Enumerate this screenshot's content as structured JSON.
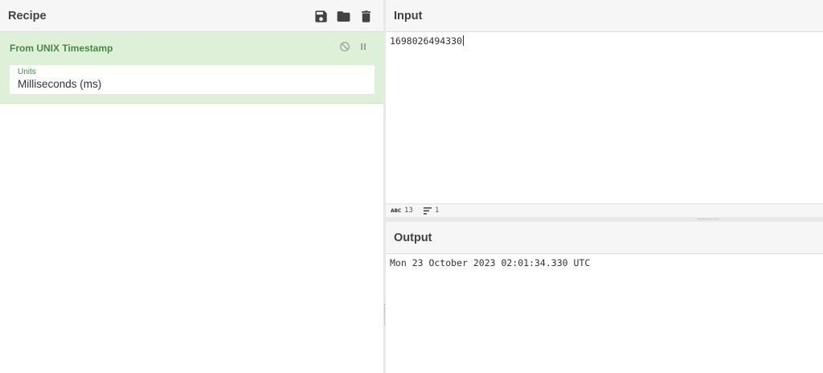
{
  "recipe": {
    "title": "Recipe",
    "tools": {
      "save_icon": "save-icon",
      "load_icon": "folder-icon",
      "clear_icon": "trash-icon"
    },
    "operation": {
      "name": "From UNIX Timestamp",
      "argument_label": "Units",
      "argument_value": "Milliseconds (ms)"
    }
  },
  "input": {
    "title": "Input",
    "value": "1698026494330",
    "status": {
      "length": "13",
      "lines": "1"
    }
  },
  "output": {
    "title": "Output",
    "value": "Mon 23 October 2023 02:01:34.330 UTC"
  },
  "colors": {
    "operation_bg": "#dff0d8",
    "operation_text": "#468847",
    "header_bg": "#f6f6f6"
  }
}
